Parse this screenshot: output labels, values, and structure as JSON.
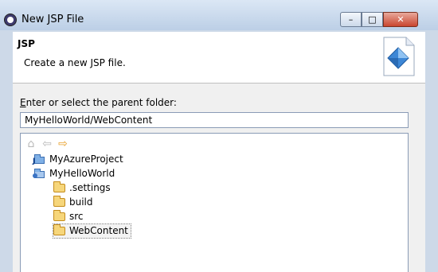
{
  "window": {
    "title": "New JSP File",
    "controls": {
      "minimize": "–",
      "maximize": "□",
      "close": "✕"
    }
  },
  "header": {
    "title": "JSP",
    "description": "Create a new JSP file."
  },
  "folder_selection": {
    "label_mnemonic": "E",
    "label_rest": "nter or select the parent folder:",
    "value": "MyHelloWorld/WebContent"
  },
  "tree": {
    "toolbar": {
      "home_icon": "⌂",
      "back_icon": "⇦",
      "forward_icon": "⇨"
    },
    "items": [
      {
        "label": "MyAzureProject",
        "level": 0,
        "type": "project"
      },
      {
        "label": "MyHelloWorld",
        "level": 0,
        "type": "project"
      },
      {
        "label": ".settings",
        "level": 1,
        "type": "folder"
      },
      {
        "label": "build",
        "level": 1,
        "type": "folder"
      },
      {
        "label": "src",
        "level": 1,
        "type": "folder"
      },
      {
        "label": "WebContent",
        "level": 1,
        "type": "folder",
        "selected": true
      }
    ]
  },
  "colors": {
    "window_frame": "#cdd9e8",
    "title_bar_top": "#dbe7f5",
    "title_bar_bottom": "#bccfe6",
    "close_button": "#c9452f",
    "folder_fill": "#f6d67b",
    "forward_arrow": "#e8a02c"
  }
}
